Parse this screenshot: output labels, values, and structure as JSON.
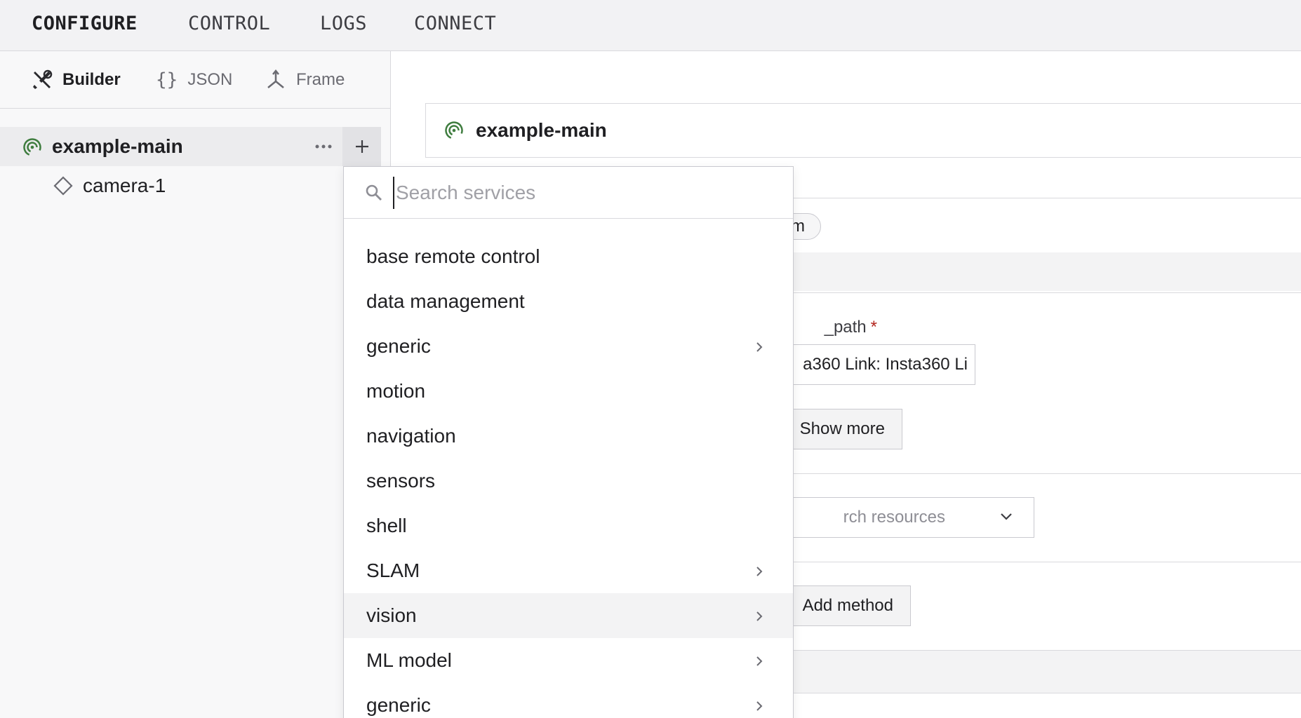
{
  "topnav": {
    "tabs": [
      {
        "label": "CONFIGURE",
        "active": true
      },
      {
        "label": "CONTROL",
        "active": false
      },
      {
        "label": "LOGS",
        "active": false
      },
      {
        "label": "CONNECT",
        "active": false
      }
    ]
  },
  "left_panel": {
    "view_tabs": [
      {
        "label": "Builder",
        "icon": "tools-icon",
        "active": true
      },
      {
        "label": "JSON",
        "icon": "braces-icon",
        "active": false
      },
      {
        "label": "Frame",
        "icon": "axes-icon",
        "active": false
      }
    ],
    "tree": {
      "machine": {
        "label": "example-main",
        "icon": "machine-status-icon"
      },
      "components": [
        {
          "label": "camera-1",
          "icon": "diamond-icon"
        }
      ]
    }
  },
  "main": {
    "header_title": "example-main",
    "pill_text": "m",
    "field_label": "_path",
    "field_required_mark": "*",
    "path_value": "a360 Link: Insta360 Li",
    "show_more_label": "Show more",
    "resources_placeholder": "rch resources",
    "add_method_label": "Add method"
  },
  "services_dropdown": {
    "search_placeholder": "Search services",
    "search_value": "",
    "items": [
      {
        "label": "base remote control",
        "has_submenu": false,
        "highlighted": false
      },
      {
        "label": "data management",
        "has_submenu": false,
        "highlighted": false
      },
      {
        "label": "generic",
        "has_submenu": true,
        "highlighted": false
      },
      {
        "label": "motion",
        "has_submenu": false,
        "highlighted": false
      },
      {
        "label": "navigation",
        "has_submenu": false,
        "highlighted": false
      },
      {
        "label": "sensors",
        "has_submenu": false,
        "highlighted": false
      },
      {
        "label": "shell",
        "has_submenu": false,
        "highlighted": false
      },
      {
        "label": "SLAM",
        "has_submenu": true,
        "highlighted": false
      },
      {
        "label": "vision",
        "has_submenu": true,
        "highlighted": true
      },
      {
        "label": "ML model",
        "has_submenu": true,
        "highlighted": false
      },
      {
        "label": "generic",
        "has_submenu": true,
        "highlighted": false
      }
    ]
  },
  "colors": {
    "machine_status": "#3f7d3f",
    "highlight": "#f3f3f4",
    "required": "#b3261e"
  }
}
